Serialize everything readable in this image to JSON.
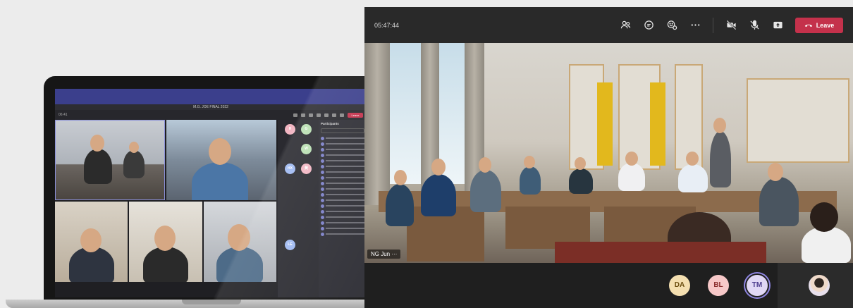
{
  "laptop": {
    "app_title": "M.G. JOE FINAL 2022",
    "timer": "06:41",
    "leave_label": "Leave",
    "participants_title": "Participants",
    "avatars": [
      {
        "initials": "H",
        "color": "#f2b6c3"
      },
      {
        "initials": "G",
        "color": "#b9dfb2"
      },
      {
        "initials": "W",
        "color": "#b9dfb2"
      },
      {
        "initials": "HX",
        "color": "#9fb9f2"
      },
      {
        "initials": "黄",
        "color": "#f2b6c3"
      },
      {
        "initials": "LE",
        "color": "#9fb9f2"
      }
    ]
  },
  "meeting": {
    "timer": "05:47:44",
    "leave_label": "Leave",
    "speaker_caption": "NG Jun",
    "caption_more": "···",
    "controls": [
      {
        "name": "people-icon"
      },
      {
        "name": "chat-icon"
      },
      {
        "name": "reactions-icon"
      },
      {
        "name": "more-options-icon"
      },
      {
        "name": "camera-off-icon"
      },
      {
        "name": "mic-off-icon"
      },
      {
        "name": "share-screen-icon"
      }
    ],
    "participants": [
      {
        "initials": "DA",
        "color": "#f4dfb0"
      },
      {
        "initials": "BL",
        "color": "#f7c8c8"
      },
      {
        "initials": "TM",
        "color": "#e0d8f5"
      }
    ],
    "colors": {
      "leave": "#c4314b",
      "toolbar": "#292929",
      "accent": "#8f86e2"
    }
  }
}
